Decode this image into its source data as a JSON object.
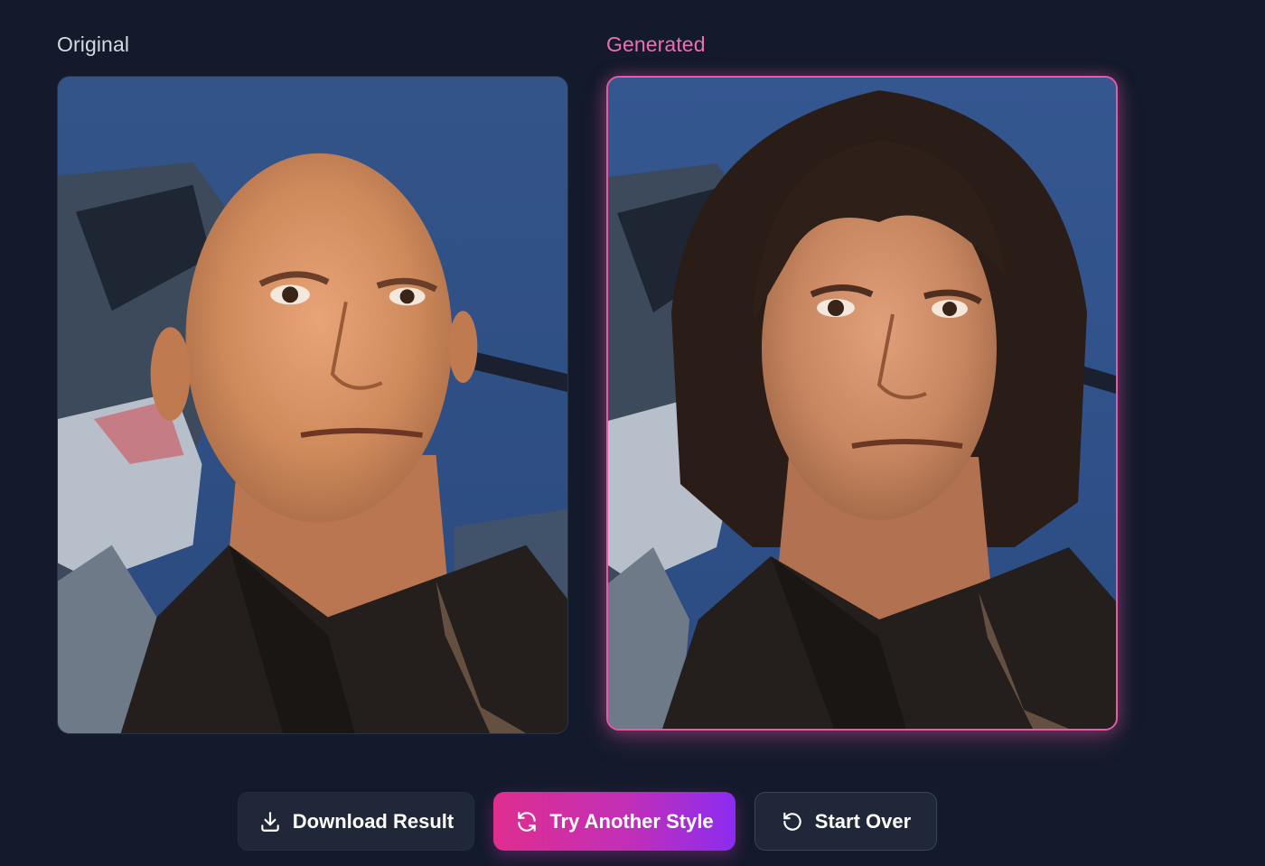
{
  "panels": {
    "original": {
      "label": "Original",
      "image_description_icon": "portrait-photo-icon"
    },
    "generated": {
      "label": "Generated",
      "image_description_icon": "portrait-photo-icon"
    }
  },
  "actions": {
    "download": {
      "label": "Download Result",
      "icon": "download-icon"
    },
    "try_style": {
      "label": "Try Another Style",
      "icon": "refresh-icon"
    },
    "start_over": {
      "label": "Start Over",
      "icon": "undo-icon"
    }
  },
  "colors": {
    "background": "#131a2b",
    "accent_pink": "#e85aa8",
    "gradient_start": "#df2e8f",
    "gradient_end": "#8b2cf0",
    "button_dark": "#1f2738"
  }
}
